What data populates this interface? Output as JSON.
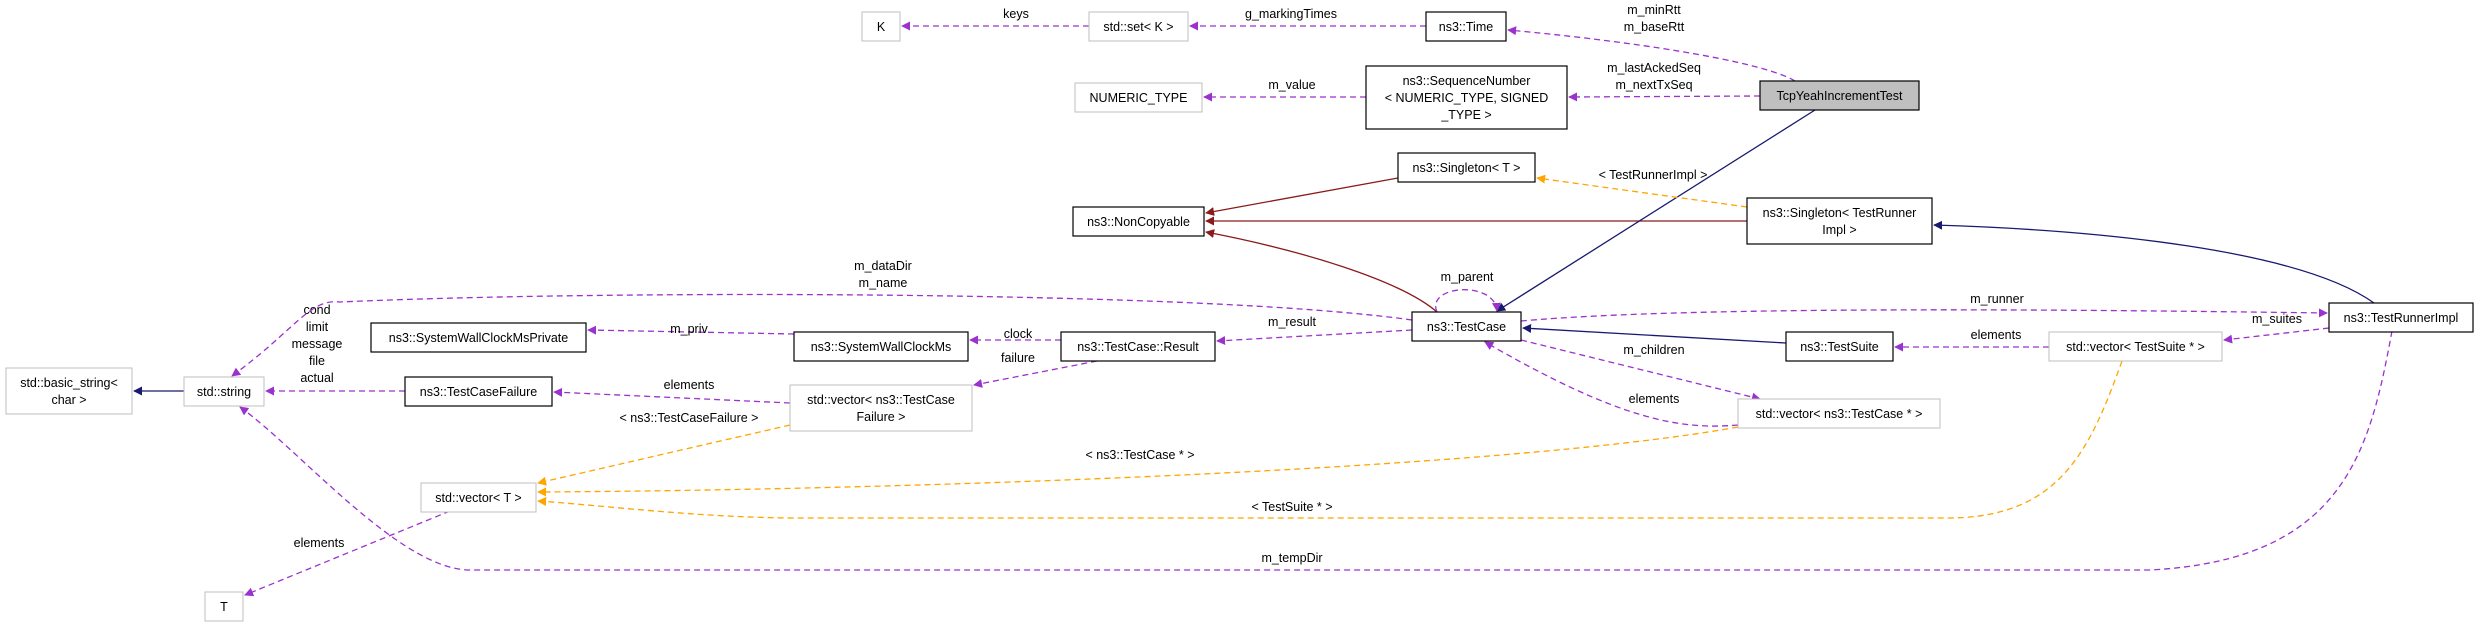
{
  "diagram": {
    "colors": {
      "member": "#9a32cd",
      "inherit_public": "#191970",
      "inherit_private": "#8b1a1a",
      "template": "#ffa500",
      "focus_fill": "#bfbfbf",
      "undocumented_border": "#bfbfbf"
    },
    "nodes": [
      {
        "id": "K",
        "lines": [
          "K"
        ]
      },
      {
        "id": "set",
        "lines": [
          "std::set< K >"
        ]
      },
      {
        "id": "time",
        "lines": [
          "ns3::Time"
        ]
      },
      {
        "id": "tcp",
        "lines": [
          "TcpYeahIncrementTest"
        ]
      },
      {
        "id": "seq",
        "lines": [
          "ns3::SequenceNumber",
          "< NUMERIC_TYPE, SIGNED",
          "_TYPE >"
        ]
      },
      {
        "id": "numeric",
        "lines": [
          "NUMERIC_TYPE"
        ]
      },
      {
        "id": "singT",
        "lines": [
          "ns3::Singleton< T >"
        ]
      },
      {
        "id": "noncopy",
        "lines": [
          "ns3::NonCopyable"
        ]
      },
      {
        "id": "singTR",
        "lines": [
          "ns3::Singleton< TestRunner",
          "Impl >"
        ]
      },
      {
        "id": "testcase",
        "lines": [
          "ns3::TestCase"
        ]
      },
      {
        "id": "runner",
        "lines": [
          "ns3::TestRunnerImpl"
        ]
      },
      {
        "id": "suite",
        "lines": [
          "ns3::TestSuite"
        ]
      },
      {
        "id": "vecSuite",
        "lines": [
          "std::vector< TestSuite * >"
        ]
      },
      {
        "id": "vecCase",
        "lines": [
          "std::vector< ns3::TestCase * >"
        ]
      },
      {
        "id": "result",
        "lines": [
          "ns3::TestCase::Result"
        ]
      },
      {
        "id": "swcm",
        "lines": [
          "ns3::SystemWallClockMs"
        ]
      },
      {
        "id": "swcmp",
        "lines": [
          "ns3::SystemWallClockMsPrivate"
        ]
      },
      {
        "id": "failure",
        "lines": [
          "ns3::TestCaseFailure"
        ]
      },
      {
        "id": "vecFail",
        "lines": [
          "std::vector< ns3::TestCase",
          "Failure >"
        ]
      },
      {
        "id": "string",
        "lines": [
          "std::string"
        ]
      },
      {
        "id": "basic",
        "lines": [
          "std::basic_string<",
          "char >"
        ]
      },
      {
        "id": "vecT",
        "lines": [
          "std::vector< T >"
        ]
      },
      {
        "id": "T",
        "lines": [
          "T"
        ]
      }
    ],
    "edges": [
      {
        "id": "e1",
        "kind": "member",
        "lines": [
          "keys"
        ]
      },
      {
        "id": "e2",
        "kind": "member",
        "lines": [
          "g_markingTimes"
        ]
      },
      {
        "id": "e3",
        "kind": "member",
        "lines": [
          "m_minRtt",
          "m_baseRtt"
        ]
      },
      {
        "id": "e4",
        "kind": "member",
        "lines": [
          "m_lastAckedSeq",
          "m_nextTxSeq"
        ]
      },
      {
        "id": "e5",
        "kind": "member",
        "lines": [
          "m_value"
        ]
      },
      {
        "id": "e6",
        "kind": "inherit_private",
        "lines": []
      },
      {
        "id": "e7",
        "kind": "inherit_private",
        "lines": []
      },
      {
        "id": "e8",
        "kind": "inherit_private",
        "lines": []
      },
      {
        "id": "e9",
        "kind": "inherit_public",
        "lines": []
      },
      {
        "id": "e10",
        "kind": "template",
        "lines": [
          "< TestRunnerImpl >"
        ]
      },
      {
        "id": "e11",
        "kind": "inherit_public",
        "lines": []
      },
      {
        "id": "e12",
        "kind": "member",
        "lines": [
          "m_parent"
        ]
      },
      {
        "id": "e13",
        "kind": "member",
        "lines": [
          "m_runner"
        ]
      },
      {
        "id": "e14",
        "kind": "member",
        "lines": [
          "m_result"
        ]
      },
      {
        "id": "e15",
        "kind": "member",
        "lines": [
          "clock"
        ]
      },
      {
        "id": "e16",
        "kind": "member",
        "lines": [
          "m_priv"
        ]
      },
      {
        "id": "e17",
        "kind": "member",
        "lines": [
          "failure"
        ]
      },
      {
        "id": "e18",
        "kind": "member",
        "lines": [
          "elements"
        ]
      },
      {
        "id": "e19",
        "kind": "member",
        "lines": [
          "cond",
          "limit",
          "message",
          "file",
          "actual"
        ]
      },
      {
        "id": "e20",
        "kind": "inherit_public",
        "lines": []
      },
      {
        "id": "e21",
        "kind": "member",
        "lines": [
          "m_dataDir",
          "m_name"
        ]
      },
      {
        "id": "e22",
        "kind": "member",
        "lines": [
          "m_tempDir"
        ]
      },
      {
        "id": "e23",
        "kind": "template",
        "lines": [
          "< ns3::TestCaseFailure >"
        ]
      },
      {
        "id": "e24",
        "kind": "template",
        "lines": [
          "< ns3::TestCase * >"
        ]
      },
      {
        "id": "e25",
        "kind": "template",
        "lines": [
          "< TestSuite * >"
        ]
      },
      {
        "id": "e26",
        "kind": "member",
        "lines": [
          "elements"
        ]
      },
      {
        "id": "e27",
        "kind": "member",
        "lines": [
          "m_children"
        ]
      },
      {
        "id": "e28",
        "kind": "member",
        "lines": [
          "elements"
        ]
      },
      {
        "id": "e29",
        "kind": "inherit_public",
        "lines": []
      },
      {
        "id": "e30",
        "kind": "member",
        "lines": [
          "elements"
        ]
      },
      {
        "id": "e31",
        "kind": "member",
        "lines": [
          "m_suites"
        ]
      }
    ]
  }
}
